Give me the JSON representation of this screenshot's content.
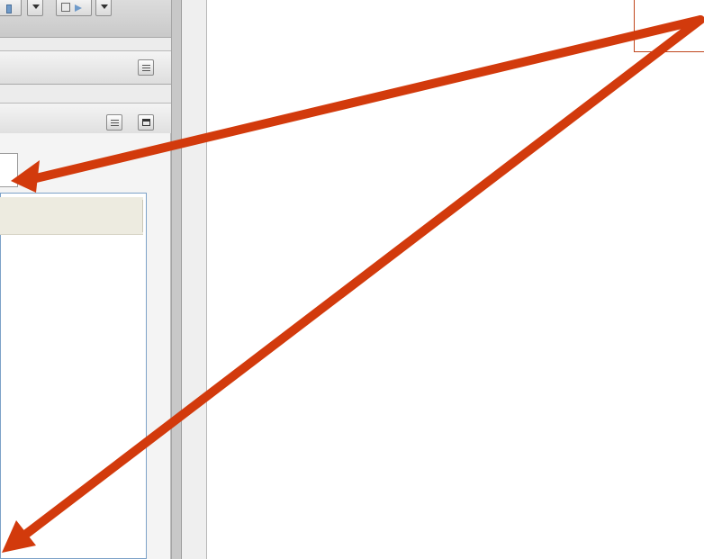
{
  "annotation": {
    "arrow_color": "#d23a0c",
    "callout_border_color": "#c0471e",
    "arrow_count": 2
  },
  "ide": {
    "toolbar": {
      "buttons": [
        "step-button-icon",
        "dropdown-icon",
        "run-config-icon",
        "dropdown-icon"
      ]
    },
    "panels": [
      {
        "header_icons": [
          "view-menu-icon"
        ]
      },
      {
        "header_icons": [
          "view-menu-icon",
          "maximize-icon"
        ]
      }
    ],
    "table_border_color": "#7da2c8",
    "table_header_color": "#edebe0"
  }
}
